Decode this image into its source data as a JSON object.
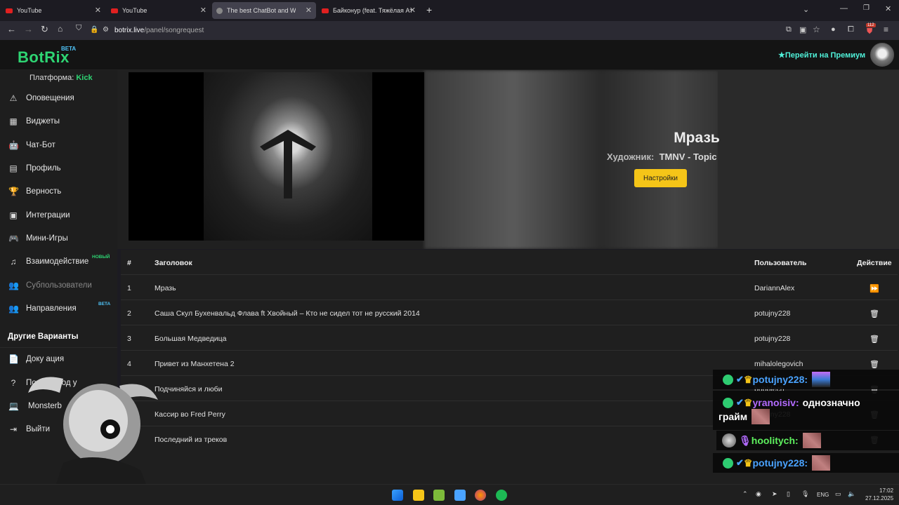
{
  "browser": {
    "tabs": [
      {
        "label": "YouTube",
        "active": false
      },
      {
        "label": "YouTube",
        "active": false
      },
      {
        "label": "The best ChatBot and Widge",
        "active": true
      },
      {
        "label": "Байконур (feat. Тяжёлая Атлет",
        "active": false
      }
    ],
    "new_tab": "+",
    "url_host": "botrix.live",
    "url_path": "/panel/songrequest",
    "extension_badge": "112"
  },
  "header": {
    "logo": "BotRix",
    "logo_badge": "BETA",
    "premium_label": "Перейти на Премиум",
    "premium_icon": "★"
  },
  "sidebar": {
    "platform_label": "Платформа:",
    "platform_value": "Kick",
    "items": [
      {
        "label": "Оповещения",
        "icon": "⚠",
        "badge": ""
      },
      {
        "label": "Виджеты",
        "icon": "▦",
        "badge": ""
      },
      {
        "label": "Чат-Бот",
        "icon": "🤖",
        "badge": ""
      },
      {
        "label": "Профиль",
        "icon": "▤",
        "badge": ""
      },
      {
        "label": "Верность",
        "icon": "🏆",
        "badge": ""
      },
      {
        "label": "Интеграции",
        "icon": "▣",
        "badge": ""
      },
      {
        "label": "Мини-Игры",
        "icon": "🎮",
        "badge": ""
      },
      {
        "label": "Взаимодействие",
        "icon": "♫",
        "badge": "НОВЫЙ"
      },
      {
        "label": "Субпользователи",
        "icon": "👥",
        "badge": ""
      },
      {
        "label": "Направления",
        "icon": "👥",
        "badge": "BETA"
      }
    ],
    "other_heading": "Другие Варианты",
    "other_items": [
      {
        "label": "Доку    ация",
        "icon": "📄"
      },
      {
        "label": "Получи    Под    у",
        "icon": "?"
      },
      {
        "label": "Monsterb",
        "icon": "💻"
      },
      {
        "label": "Выйти",
        "icon": "⇥"
      }
    ]
  },
  "now_playing": {
    "title": "Мразь",
    "artist_label": "Художник:",
    "artist": "TMNV - Topic",
    "settings_button": "Настройки"
  },
  "queue": {
    "headers": {
      "num": "#",
      "title": "Заголовок",
      "user": "Пользователь",
      "action": "Действие"
    },
    "rows": [
      {
        "num": "1",
        "title": "Мразь",
        "user": "DariannAlex",
        "action": "skip"
      },
      {
        "num": "2",
        "title": "Саша Скул Бухенвальд Флава ft Хвойный – Кто не сидел тот не русский 2014",
        "user": "potujny228",
        "action": "delete"
      },
      {
        "num": "3",
        "title": "Большая Медведица",
        "user": "potujny228",
        "action": "delete"
      },
      {
        "num": "4",
        "title": "Привет из Манхетена 2",
        "user": "mihalolegovich",
        "action": "delete"
      },
      {
        "num": "5",
        "title": "Подчиняйся и люби",
        "user": "bubblech",
        "action": "delete"
      },
      {
        "num": "6",
        "title": "Кассир во Fred Perry",
        "user": "potujny228",
        "action": "delete"
      },
      {
        "num": "7",
        "title": "Последний из треков",
        "user": "",
        "action": "delete"
      }
    ]
  },
  "chat_overlay": [
    {
      "user": "potujny228:",
      "message": "",
      "user_color": "#4aa3ff"
    },
    {
      "user": "yranoisiv:",
      "message": "однозначно",
      "user_color": "#b36bff"
    },
    {
      "user": "",
      "message": "грайм",
      "user_color": "#ffffff"
    },
    {
      "user": "hoolitych:",
      "message": "",
      "user_color": "#5ef05e"
    },
    {
      "user": "potujny228:",
      "message": "",
      "user_color": "#4aa3ff"
    }
  ],
  "taskbar": {
    "lang": "ENG",
    "time": "17:02",
    "date": "27.12.2025"
  }
}
